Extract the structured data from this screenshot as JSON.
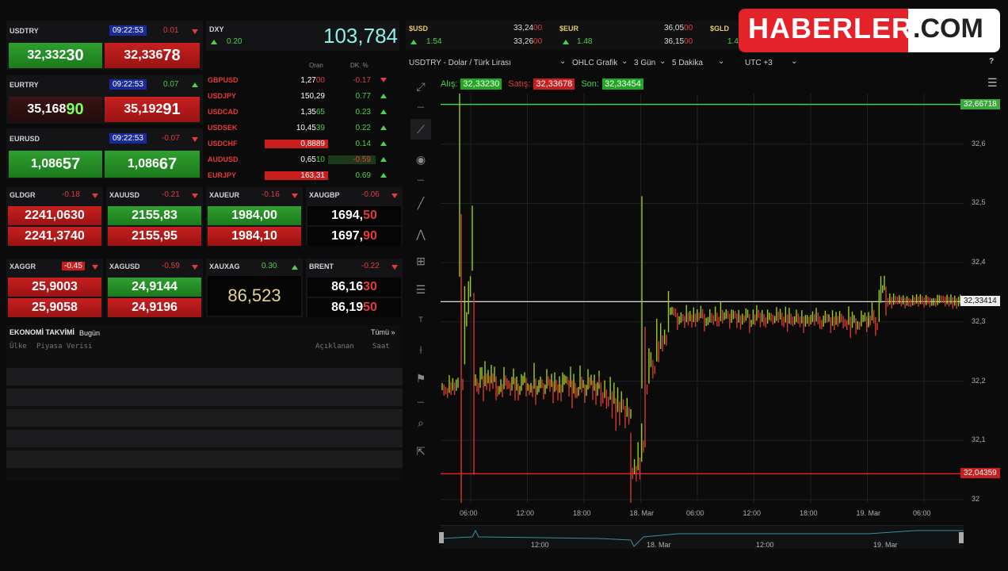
{
  "logo": {
    "name": "HABERLER",
    "domain": ".COM"
  },
  "quotes_left": [
    {
      "symbol": "USDTRY",
      "time": "09:22:53",
      "change": "0.01",
      "dir": "down",
      "bid_main": "32,332",
      "bid_end": "30",
      "ask_main": "32,336",
      "ask_end": "78"
    },
    {
      "symbol": "EURTRY",
      "time": "09:22:53",
      "change": "0.07",
      "dir": "up",
      "bid_main": "35,168",
      "bid_end": "90",
      "ask_main": "35,192",
      "ask_end": "91"
    },
    {
      "symbol": "EURUSD",
      "time": "09:22:53",
      "change": "-0.07",
      "dir": "down",
      "bid_main": "1,086",
      "bid_end": "57",
      "ask_main": "1,086",
      "ask_end": "67"
    }
  ],
  "dxy": {
    "label": "DXY",
    "change": "0.20",
    "value": "103,784"
  },
  "fx_headers": {
    "rate": "Oran",
    "change": "DK. %"
  },
  "fx_rows": [
    {
      "symbol": "GBPUSD",
      "rate": "1,27",
      "rate_end": "00",
      "change": "-0.17",
      "dir": "down"
    },
    {
      "symbol": "USDJPY",
      "rate": "150,29",
      "rate_end": "",
      "change": "0.77",
      "dir": "up"
    },
    {
      "symbol": "USDCAD",
      "rate": "1,35",
      "rate_end": "65",
      "change": "0.23",
      "dir": "up"
    },
    {
      "symbol": "USDSEK",
      "rate": "10,45",
      "rate_end": "39",
      "change": "0.22",
      "dir": "up"
    },
    {
      "symbol": "USDCHF",
      "rate": "0,8889",
      "rate_end": "",
      "change": "0.14",
      "dir": "up"
    },
    {
      "symbol": "AUDUSD",
      "rate": "0,65",
      "rate_end": "10",
      "change": "-0.59",
      "dir": "up"
    },
    {
      "symbol": "EURJPY",
      "rate": "163,31",
      "rate_end": "",
      "change": "0.69",
      "dir": "up"
    }
  ],
  "metals_row1": [
    {
      "symbol": "GLDGR",
      "change": "-0.18",
      "dir": "down",
      "top": "2241,0630",
      "bottom": "2241,3740"
    },
    {
      "symbol": "XAUUSD",
      "change": "-0.21",
      "dir": "down",
      "top": "2155,83",
      "bottom": "2155,95"
    },
    {
      "symbol": "XAUEUR",
      "change": "-0.16",
      "dir": "down",
      "top": "1984,00",
      "bottom": "1984,10"
    },
    {
      "symbol": "XAUGBP",
      "change": "-0.06",
      "dir": "down",
      "top": "1694,",
      "top_end": "50",
      "bottom": "1697,",
      "bottom_end": "90"
    }
  ],
  "metals_row2": [
    {
      "symbol": "XAGGR",
      "change": "-0.45",
      "dir": "down",
      "top": "25,9003",
      "bottom": "25,9058"
    },
    {
      "symbol": "XAGUSD",
      "change": "-0.59",
      "dir": "down",
      "top": "24,9144",
      "bottom": "24,9196"
    },
    {
      "symbol": "XAUXAG",
      "change": "0.30",
      "dir": "up",
      "single": "86,523"
    },
    {
      "symbol": "BRENT",
      "change": "-0.22",
      "dir": "down",
      "top": "86,16",
      "top_end": "30",
      "bottom": "86,19",
      "bottom_end": "50"
    }
  ],
  "calendar": {
    "title": "EKONOMİ TAKVİMİ",
    "period": "Bugün",
    "all": "Tümü »",
    "cols": [
      "Ülke",
      "Piyasa Verisi",
      "Açıklanan",
      "Saat"
    ]
  },
  "ticker_top": [
    {
      "symbol": "$USD",
      "change": "1.54",
      "a": "33,24",
      "a_end": "00",
      "b": "33,26",
      "b_end": "00"
    },
    {
      "symbol": "$EUR",
      "change": "1.48",
      "a": "36,05",
      "a_end": "00",
      "b": "36,15",
      "b_end": "00"
    },
    {
      "symbol": "$GLD",
      "change": "1.4"
    }
  ],
  "chart_toolbar": {
    "instrument": "USDTRY - Dolar / Türk Lirası",
    "type": "OHLC Grafik",
    "range": "3 Gün",
    "interval": "5 Dakika",
    "tz": "UTC +3",
    "help": "?"
  },
  "chart_tags": {
    "bid_label": "Alış:",
    "bid": "32,33230",
    "ask_label": "Satış:",
    "ask": "32,33678",
    "last_label": "Son:",
    "last": "32,33454"
  },
  "chart_data": {
    "type": "line",
    "y_ticks": [
      "32,6",
      "32,5",
      "32,4",
      "32,3",
      "32,2",
      "32,1",
      "32"
    ],
    "x_ticks": [
      "06:00",
      "12:00",
      "18:00",
      "18. Mar",
      "06:00",
      "12:00",
      "18:00",
      "19. Mar",
      "06:00"
    ],
    "nav_ticks": [
      "12:00",
      "18. Mar",
      "12:00",
      "19. Mar"
    ],
    "high_line": "32,66718",
    "low_line": "32,04359",
    "current": "32,33414",
    "ylim": [
      32,
      32.68
    ]
  },
  "colors": {
    "up": "#4bd14b",
    "down": "#e23b3b",
    "accent": "#1b2a9a"
  }
}
